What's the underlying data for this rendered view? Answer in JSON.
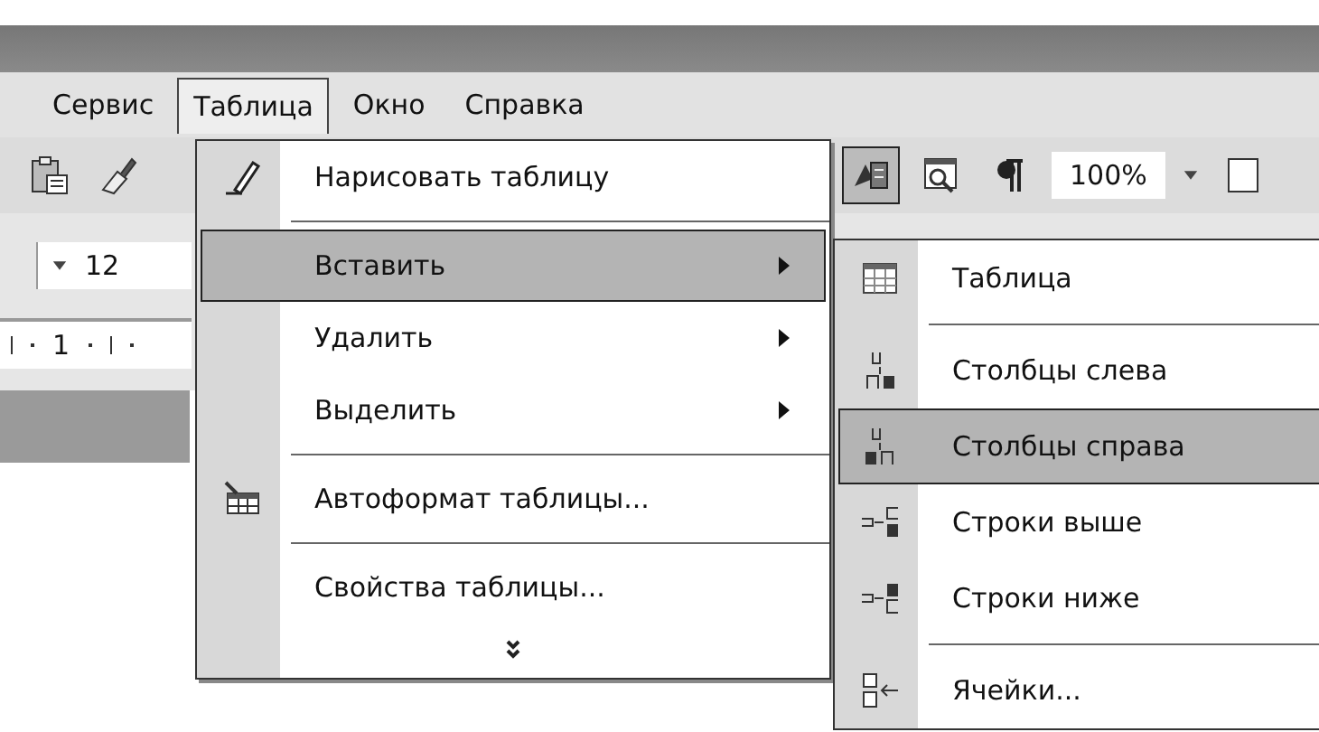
{
  "menubar": [
    {
      "label": "Сервис",
      "selected": false
    },
    {
      "label": "Таблица",
      "selected": true
    },
    {
      "label": "Окно",
      "selected": false
    },
    {
      "label": "Справка",
      "selected": false
    }
  ],
  "toolbar": {
    "zoom": "100%",
    "font_size": "12",
    "ruler_mark": "1"
  },
  "menu": {
    "items": [
      {
        "kind": "item",
        "label": "Нарисовать таблицу",
        "selected": false,
        "submenu": false
      },
      {
        "kind": "separator"
      },
      {
        "kind": "item",
        "label": "Вставить",
        "selected": true,
        "submenu": true
      },
      {
        "kind": "item",
        "label": "Удалить",
        "selected": false,
        "submenu": true
      },
      {
        "kind": "item",
        "label": "Выделить",
        "selected": false,
        "submenu": true
      },
      {
        "kind": "separator"
      },
      {
        "kind": "item",
        "label": "Автоформат таблицы...",
        "selected": false,
        "submenu": false
      },
      {
        "kind": "separator"
      },
      {
        "kind": "item",
        "label": "Свойства таблицы...",
        "selected": false,
        "submenu": false
      },
      {
        "kind": "expand"
      }
    ]
  },
  "submenu": {
    "items": [
      {
        "kind": "item",
        "label": "Таблица",
        "selected": false
      },
      {
        "kind": "separator"
      },
      {
        "kind": "item",
        "label": "Столбцы слева",
        "selected": false
      },
      {
        "kind": "item",
        "label": "Столбцы справа",
        "selected": true
      },
      {
        "kind": "item",
        "label": "Строки выше",
        "selected": false
      },
      {
        "kind": "item",
        "label": "Строки ниже",
        "selected": false
      },
      {
        "kind": "separator"
      },
      {
        "kind": "item",
        "label": "Ячейки...",
        "selected": false
      }
    ]
  }
}
